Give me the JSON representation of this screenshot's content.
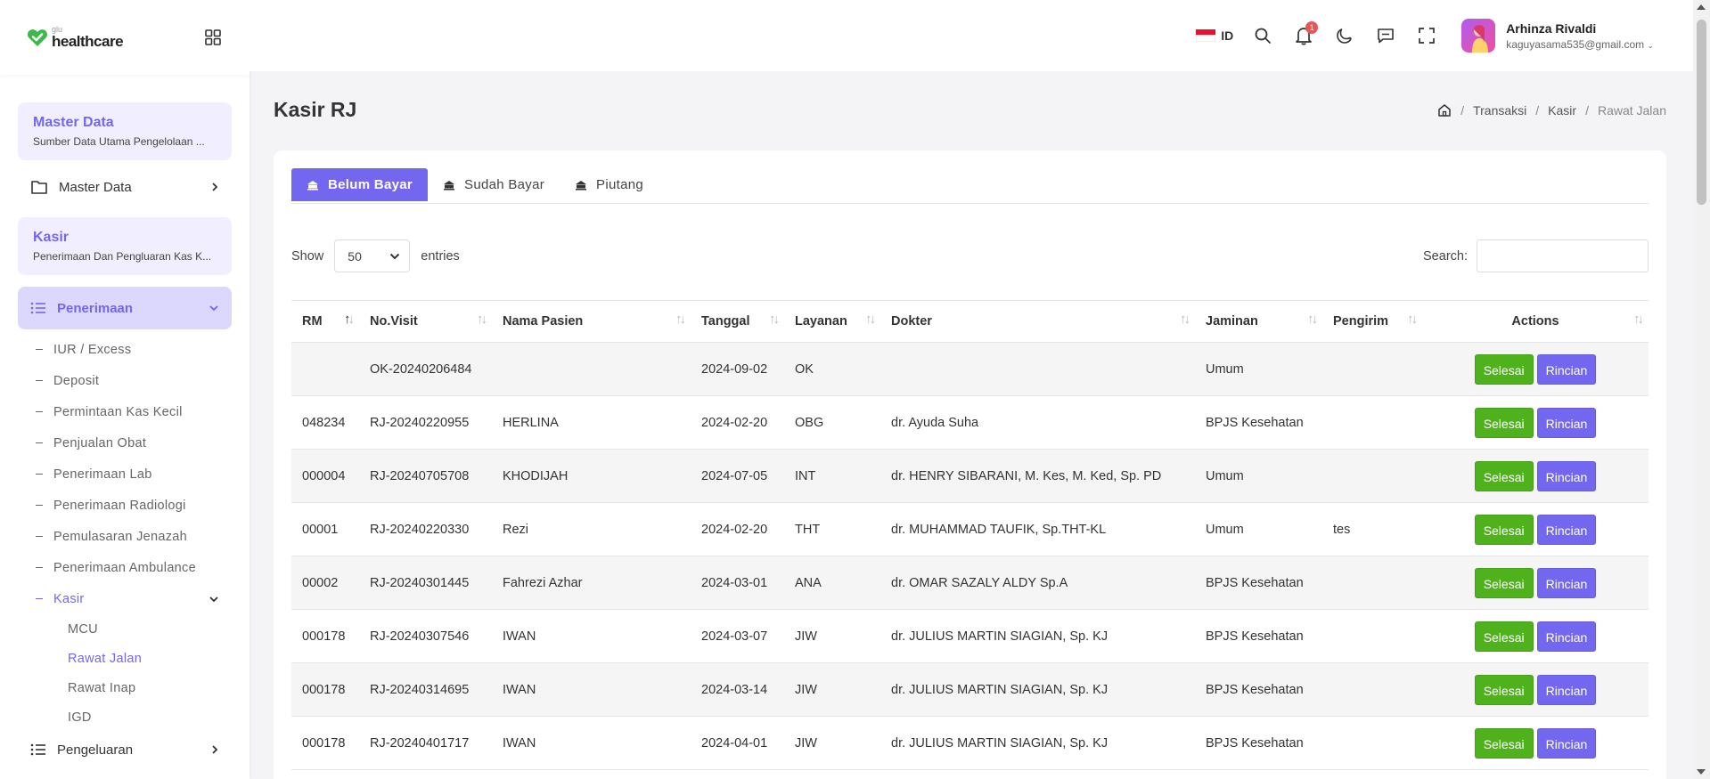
{
  "brand": {
    "small": "glu",
    "name": "healthcare"
  },
  "sidebar": {
    "master_card": {
      "title": "Master Data",
      "subtitle": "Sumber Data Utama Pengelolaan ..."
    },
    "master_item": "Master Data",
    "kasir_card": {
      "title": "Kasir",
      "subtitle": "Penerimaan Dan Pengluaran Kas K..."
    },
    "penerimaan": "Penerimaan",
    "sub_items": [
      "IUR / Excess",
      "Deposit",
      "Permintaan Kas Kecil",
      "Penjualan Obat",
      "Penerimaan Lab",
      "Penerimaan Radiologi",
      "Pemulasaran Jenazah",
      "Penerimaan Ambulance"
    ],
    "kasir_item": "Kasir",
    "kasir_sub": [
      "MCU",
      "Rawat Jalan",
      "Rawat Inap",
      "IGD"
    ],
    "pengeluaran": "Pengeluaran"
  },
  "topbar": {
    "lang": "ID",
    "notif_count": "1",
    "user_name": "Arhinza Rivaldi",
    "user_email": "kaguyasama535@gmail.com"
  },
  "page": {
    "title": "Kasir RJ",
    "breadcrumb": [
      "Transaksi",
      "Kasir",
      "Rawat Jalan"
    ]
  },
  "tabs": [
    "Belum Bayar",
    "Sudah Bayar",
    "Piutang"
  ],
  "controls": {
    "show": "Show",
    "entries": "entries",
    "page_size": "50",
    "search_label": "Search:",
    "search_value": ""
  },
  "table": {
    "columns": [
      "RM",
      "No.Visit",
      "Nama Pasien",
      "Tanggal",
      "Layanan",
      "Dokter",
      "Jaminan",
      "Pengirim",
      "Actions"
    ],
    "rows": [
      [
        "",
        "OK-20240206484",
        "",
        "2024-09-02",
        "OK",
        "",
        "Umum",
        ""
      ],
      [
        "048234",
        "RJ-20240220955",
        "HERLINA",
        "2024-02-20",
        "OBG",
        "dr. Ayuda Suha",
        "BPJS Kesehatan",
        ""
      ],
      [
        "000004",
        "RJ-20240705708",
        "KHODIJAH",
        "2024-07-05",
        "INT",
        "dr. HENRY SIBARANI, M. Kes, M. Ked, Sp. PD",
        "Umum",
        ""
      ],
      [
        "00001",
        "RJ-20240220330",
        "Rezi",
        "2024-02-20",
        "THT",
        "dr. MUHAMMAD TAUFIK, Sp.THT-KL",
        "Umum",
        "tes"
      ],
      [
        "00002",
        "RJ-20240301445",
        "Fahrezi Azhar",
        "2024-03-01",
        "ANA",
        "dr. OMAR SAZALY ALDY Sp.A",
        "BPJS Kesehatan",
        ""
      ],
      [
        "000178",
        "RJ-20240307546",
        "IWAN",
        "2024-03-07",
        "JIW",
        "dr. JULIUS MARTIN SIAGIAN, Sp. KJ",
        "BPJS Kesehatan",
        ""
      ],
      [
        "000178",
        "RJ-20240314695",
        "IWAN",
        "2024-03-14",
        "JIW",
        "dr. JULIUS MARTIN SIAGIAN, Sp. KJ",
        "BPJS Kesehatan",
        ""
      ],
      [
        "000178",
        "RJ-20240401717",
        "IWAN",
        "2024-04-01",
        "JIW",
        "dr. JULIUS MARTIN SIAGIAN, Sp. KJ",
        "BPJS Kesehatan",
        ""
      ]
    ],
    "btn_done": "Selesai",
    "btn_detail": "Rincian"
  },
  "colors": {
    "primary": "#7367f0",
    "success": "#4fb21d",
    "danger": "#ea5455"
  }
}
